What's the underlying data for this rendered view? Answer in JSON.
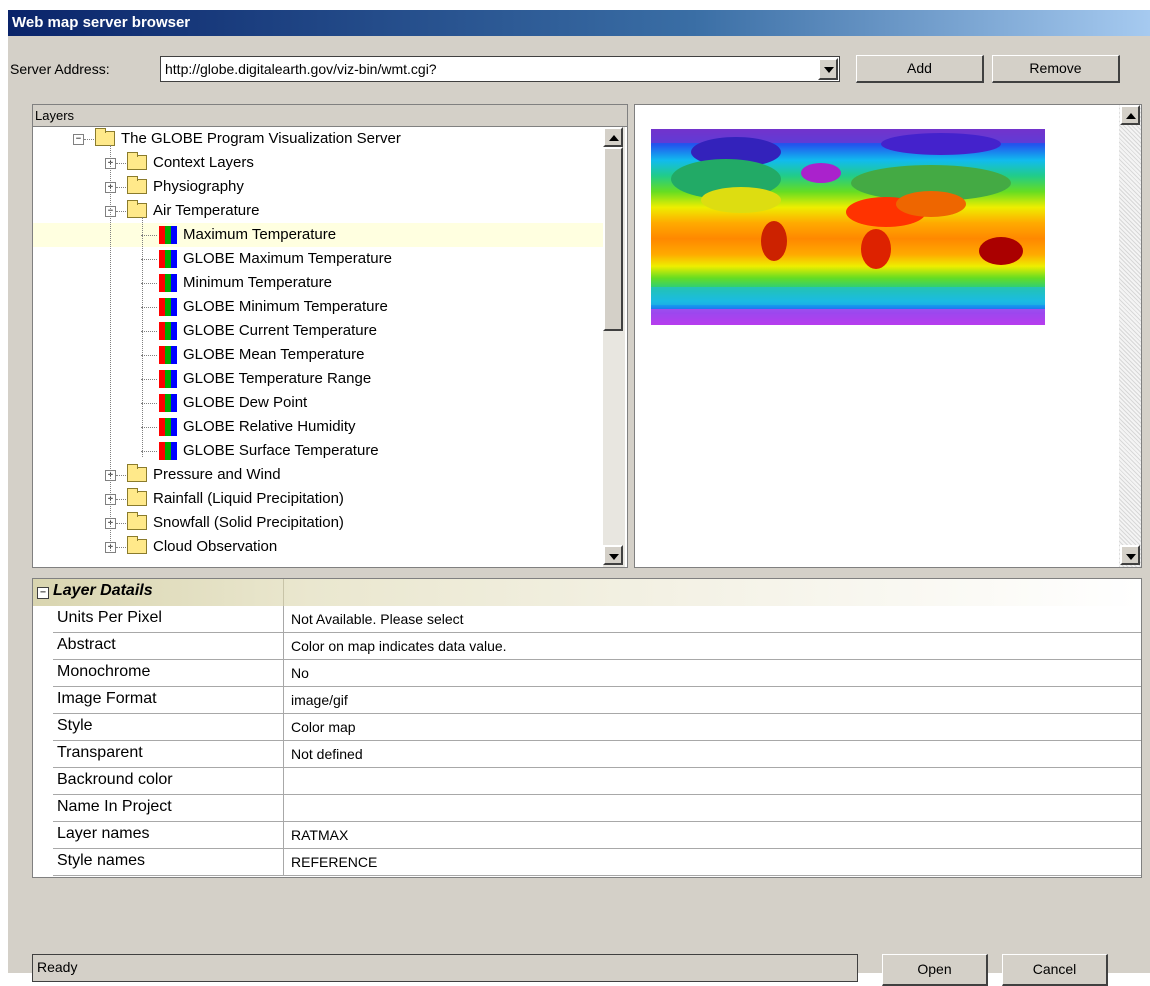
{
  "window": {
    "title": "Web map server browser"
  },
  "server": {
    "label": "Server Address:",
    "address": "http://globe.digitalearth.gov/viz-bin/wmt.cgi?",
    "add_label": "Add",
    "remove_label": "Remove"
  },
  "layers": {
    "header": "Layers",
    "nodes": [
      {
        "label": "The GLOBE Program Visualization Server",
        "kind": "folder",
        "expander": "minus"
      },
      {
        "label": "Context Layers",
        "kind": "folder",
        "expander": "plus"
      },
      {
        "label": "Physiography",
        "kind": "folder",
        "expander": "plus"
      },
      {
        "label": "Air Temperature",
        "kind": "folder",
        "expander": "minus"
      },
      {
        "label": "Maximum Temperature",
        "kind": "layer",
        "selected": true
      },
      {
        "label": "GLOBE Maximum Temperature",
        "kind": "layer"
      },
      {
        "label": "Minimum Temperature",
        "kind": "layer"
      },
      {
        "label": "GLOBE Minimum Temperature",
        "kind": "layer"
      },
      {
        "label": "GLOBE Current Temperature",
        "kind": "layer"
      },
      {
        "label": "GLOBE Mean Temperature",
        "kind": "layer"
      },
      {
        "label": "GLOBE Temperature Range",
        "kind": "layer"
      },
      {
        "label": "GLOBE Dew Point",
        "kind": "layer"
      },
      {
        "label": "GLOBE Relative Humidity",
        "kind": "layer"
      },
      {
        "label": "GLOBE Surface Temperature",
        "kind": "layer"
      },
      {
        "label": "Pressure and Wind",
        "kind": "folder",
        "expander": "plus"
      },
      {
        "label": "Rainfall (Liquid Precipitation)",
        "kind": "folder",
        "expander": "plus"
      },
      {
        "label": "Snowfall (Solid Precipitation)",
        "kind": "folder",
        "expander": "plus"
      },
      {
        "label": "Cloud Observation",
        "kind": "folder",
        "expander": "plus"
      }
    ]
  },
  "details": {
    "title": "Layer Datails",
    "rows": [
      {
        "key": "Units Per Pixel",
        "value": "Not Available. Please select"
      },
      {
        "key": "Abstract",
        "value": "Color on map indicates data value."
      },
      {
        "key": "Monochrome",
        "value": "No"
      },
      {
        "key": "Image Format",
        "value": "image/gif"
      },
      {
        "key": "Style",
        "value": "Color map"
      },
      {
        "key": "Transparent",
        "value": "Not defined"
      },
      {
        "key": "Backround color",
        "value": ""
      },
      {
        "key": "Name In Project",
        "value": ""
      },
      {
        "key": "Layer names",
        "value": "RATMAX"
      },
      {
        "key": "Style names",
        "value": "REFERENCE"
      }
    ]
  },
  "status": {
    "text": "Ready"
  },
  "footer": {
    "open_label": "Open",
    "cancel_label": "Cancel"
  },
  "icons": {
    "folder": "folder-icon",
    "layer": "layer-color-icon",
    "dropdown": "chevron-down-icon"
  },
  "colors": {
    "selection": "#ffffe0",
    "titlebar": "#0a246a",
    "window": "#d4d0c8"
  }
}
